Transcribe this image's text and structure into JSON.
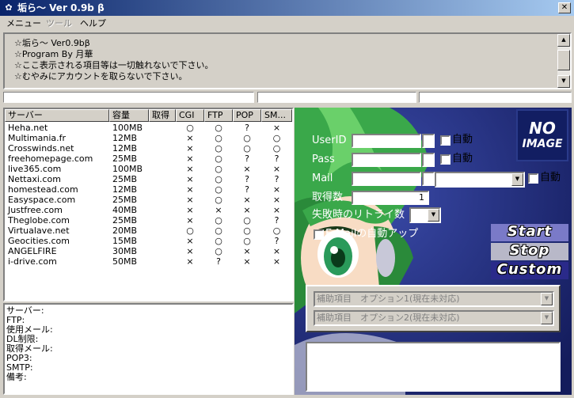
{
  "window": {
    "title": "垢ら～ Ver 0.9b β",
    "close_glyph": "✕"
  },
  "menu": {
    "items": [
      {
        "label": "メニュー",
        "enabled": true
      },
      {
        "label": "ツール",
        "enabled": false
      },
      {
        "label": "ヘルプ",
        "enabled": true
      }
    ]
  },
  "info": {
    "lines": [
      "☆垢ら～ Ver0.9bβ",
      "☆Program By 月華",
      "☆ここ表示される項目等は一切触れないで下さい。",
      "☆むやみにアカウントを取らないで下さい。"
    ]
  },
  "server_list": {
    "columns": [
      "サーバー",
      "容量",
      "取得",
      "CGI",
      "FTP",
      "POP",
      "SM..."
    ],
    "rows": [
      [
        "Heha.net",
        "100MB",
        "",
        "○",
        "○",
        "?",
        "×"
      ],
      [
        "Multimania.fr",
        "12MB",
        "",
        "×",
        "○",
        "○",
        "○"
      ],
      [
        "Crosswinds.net",
        "12MB",
        "",
        "×",
        "○",
        "○",
        "○"
      ],
      [
        "freehomepage.com",
        "25MB",
        "",
        "×",
        "○",
        "?",
        "?"
      ],
      [
        "live365.com",
        "100MB",
        "",
        "×",
        "○",
        "×",
        "×"
      ],
      [
        "Nettaxi.com",
        "25MB",
        "",
        "×",
        "○",
        "?",
        "?"
      ],
      [
        "homestead.com",
        "12MB",
        "",
        "×",
        "○",
        "?",
        "×"
      ],
      [
        "Easyspace.com",
        "25MB",
        "",
        "×",
        "○",
        "×",
        "×"
      ],
      [
        "Justfree.com",
        "40MB",
        "",
        "×",
        "×",
        "×",
        "×"
      ],
      [
        "Theglobe.com",
        "25MB",
        "",
        "×",
        "○",
        "○",
        "?"
      ],
      [
        "Virtualave.net",
        "20MB",
        "",
        "○",
        "○",
        "○",
        "○"
      ],
      [
        "Geocities.com",
        "15MB",
        "",
        "×",
        "○",
        "○",
        "?"
      ],
      [
        "ANGELFIRE",
        "30MB",
        "",
        "×",
        "○",
        "×",
        "×"
      ],
      [
        "i-drive.com",
        "50MB",
        "",
        "×",
        "?",
        "×",
        "×"
      ]
    ]
  },
  "details": {
    "labels": [
      "サーバー:",
      "FTP:",
      "使用メール:",
      "DL制限:",
      "取得メール:",
      "POP3:",
      "SMTP:",
      "備考:"
    ]
  },
  "form": {
    "userid_label": "UserID",
    "pass_label": "Pass",
    "mail_label": "Mail",
    "count_label": "取得数",
    "count_value": "1",
    "retry_label": "失敗時のリトライ数",
    "auto_label": "自動",
    "email_auto_label": "E-Mailの自動アップ",
    "no_image_line1": "NO",
    "no_image_line2": "IMAGE",
    "start_label": "Start",
    "stop_label": "Stop",
    "custom_label": "Custom",
    "option1": "補助項目　オプション1(現在未対応)",
    "option2": "補助項目　オプション2(現在未対応)"
  }
}
